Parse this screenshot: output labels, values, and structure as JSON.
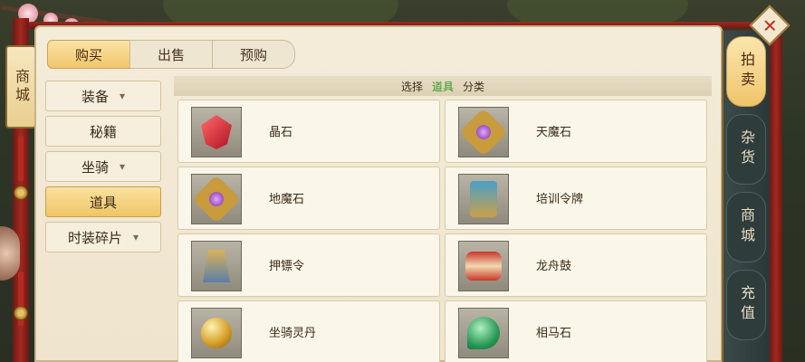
{
  "left_sign": "商城",
  "top_tabs": [
    "购买",
    "出售",
    "预购"
  ],
  "categories": [
    {
      "label": "装备",
      "expandable": true
    },
    {
      "label": "秘籍",
      "expandable": false
    },
    {
      "label": "坐骑",
      "expandable": true
    },
    {
      "label": "道具",
      "expandable": false,
      "active": true
    },
    {
      "label": "时装碎片",
      "expandable": true
    }
  ],
  "filter": {
    "prefix": "选择",
    "selected": "道具",
    "suffix": "分类"
  },
  "items": [
    {
      "name": "晶石",
      "icon": "red-crystal-icon"
    },
    {
      "name": "天魔石",
      "icon": "purple-amulet-icon"
    },
    {
      "name": "地魔石",
      "icon": "gold-amulet-icon"
    },
    {
      "name": "培训令牌",
      "icon": "training-token-icon"
    },
    {
      "name": "押镖令",
      "icon": "escort-token-icon"
    },
    {
      "name": "龙舟鼓",
      "icon": "dragon-drum-icon"
    },
    {
      "name": "坐骑灵丹",
      "icon": "golden-orb-icon"
    },
    {
      "name": "相马石",
      "icon": "jade-stone-icon"
    }
  ],
  "side_tabs": [
    {
      "label": "拍卖",
      "active": true
    },
    {
      "label": "杂货"
    },
    {
      "label": "商城"
    },
    {
      "label": "充值"
    }
  ],
  "close_glyph": "✕",
  "colors": {
    "accent_gold": "#f0c66b",
    "filter_highlight": "#2b9b1f",
    "close_red": "#c12d1f"
  }
}
